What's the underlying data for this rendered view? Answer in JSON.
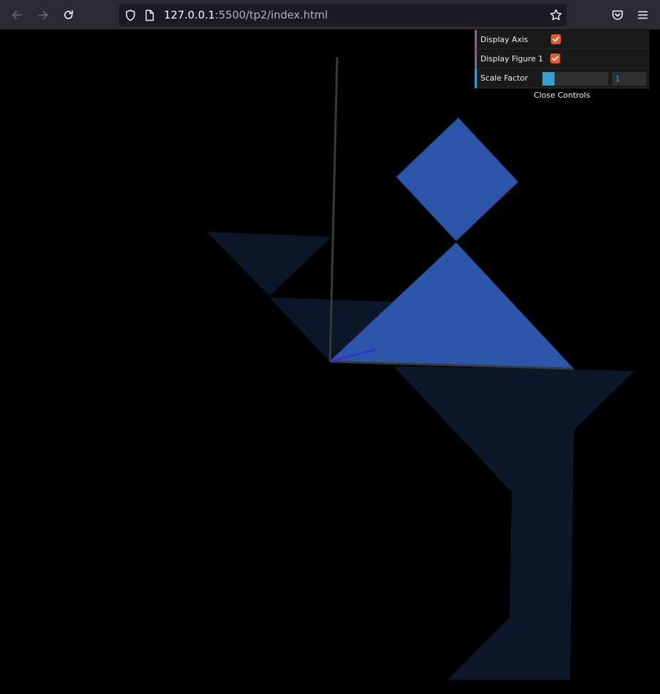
{
  "browser": {
    "url_host": "127.0.0.1",
    "url_rest": ":5500/tp2/index.html",
    "icons": [
      "back-arrow-icon",
      "forward-arrow-icon",
      "reload-icon",
      "shield-icon",
      "page-icon",
      "star-icon",
      "pocket-icon",
      "menu-icon"
    ]
  },
  "controls": {
    "display_axis_label": "Display Axis",
    "display_axis_checked": true,
    "display_figure_label": "Display Figure 1",
    "display_figure_checked": true,
    "scale_label": "Scale Factor",
    "scale_value": "1",
    "scale_fill_fraction": 0.18,
    "close_label": "Close Controls"
  },
  "colors": {
    "bright_blue": "#2b55a8",
    "dark_blue": "#0b1628",
    "checkbox": "#e55b2b",
    "slider": "#2fa1d6"
  }
}
